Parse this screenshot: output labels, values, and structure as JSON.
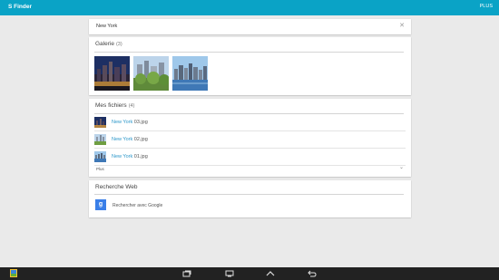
{
  "appbar": {
    "title": "S Finder",
    "plus": "PLUS"
  },
  "search": {
    "query": "New York"
  },
  "gallery": {
    "title": "Galerie",
    "count": "(3)"
  },
  "files": {
    "title": "Mes fichiers",
    "count": "(4)",
    "items": [
      {
        "match": "New York",
        "rest": " 03.jpg"
      },
      {
        "match": "New York",
        "rest": " 02.jpg"
      },
      {
        "match": "New York",
        "rest": " 01.jpg"
      }
    ],
    "more": "Plus"
  },
  "web": {
    "title": "Recherche Web",
    "google_label": "Rechercher avec Google",
    "google_letter": "g"
  },
  "colors": {
    "appbar": "#0aa3c6",
    "highlight": "#2b97c9",
    "google": "#3a7fe8",
    "navbar": "#222222"
  }
}
